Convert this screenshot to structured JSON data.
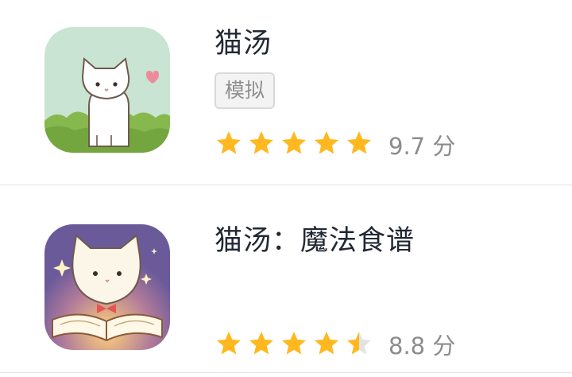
{
  "apps": [
    {
      "title": "猫汤",
      "tag": "模拟",
      "rating_stars": 5,
      "score_text": "9.7 分",
      "icon": "white-cat-on-grass-with-heart-icon"
    },
    {
      "title": "猫汤：魔法食谱",
      "tag": "",
      "rating_stars": 4.5,
      "score_text": "8.8 分",
      "icon": "cat-with-magic-book-icon"
    }
  ],
  "colors": {
    "star_filled": "#ffb81f",
    "star_empty": "#e3e3e3",
    "title": "#222833",
    "score": "#8c8c8c"
  }
}
